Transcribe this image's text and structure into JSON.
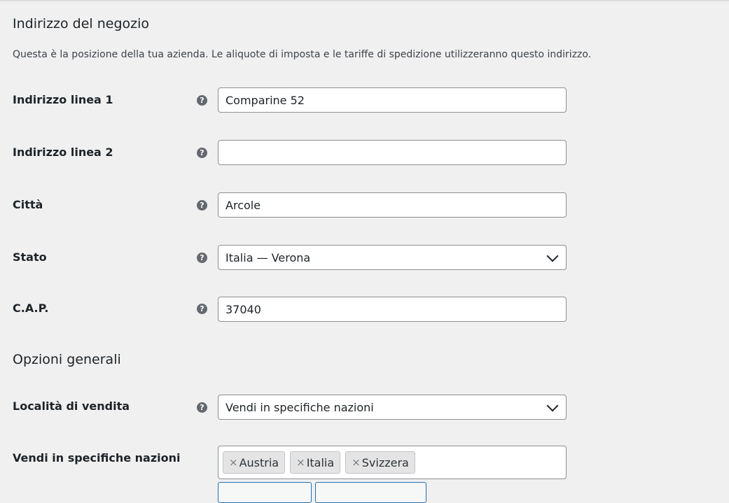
{
  "store_address": {
    "title": "Indirizzo del negozio",
    "description": "Questa è la posizione della tua azienda. Le aliquote di imposta e le tariffe di spedizione utilizzeranno questo indirizzo.",
    "address1": {
      "label": "Indirizzo linea 1",
      "value": "Comparine 52"
    },
    "address2": {
      "label": "Indirizzo linea 2",
      "value": ""
    },
    "city": {
      "label": "Città",
      "value": "Arcole"
    },
    "state": {
      "label": "Stato",
      "value": "Italia — Verona"
    },
    "postcode": {
      "label": "C.A.P.",
      "value": "37040"
    }
  },
  "general_options": {
    "title": "Opzioni generali",
    "selling_location": {
      "label": "Località di vendita",
      "value": "Vendi in specifiche nazioni"
    },
    "specific_countries": {
      "label": "Vendi in specifiche nazioni",
      "chips": [
        "Austria",
        "Italia",
        "Svizzera"
      ],
      "remove_glyph": "×"
    }
  },
  "help_glyph": "?",
  "icons": {
    "help": "question-circle-icon",
    "dropdown": "chevron-down-icon",
    "remove": "close-icon"
  },
  "colors": {
    "background": "#f0f0f1",
    "field_border": "#8c8f94",
    "help_icon": "#646970",
    "button_accent": "#2271b1"
  }
}
